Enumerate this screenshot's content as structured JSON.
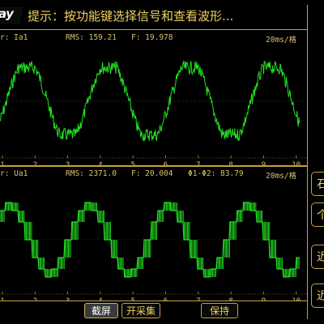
{
  "header": {
    "logo": "ay",
    "prompt": "提示：按功能键选择信号和查看波形..."
  },
  "panel_top": {
    "channel": "r: Ia1",
    "rms": "RMS: 159.21",
    "freq": "F: 19.978",
    "scale": "20ms/格",
    "ticks": [
      "1",
      "2",
      "3",
      "4",
      "5",
      "6",
      "7",
      "8",
      "9",
      "10"
    ]
  },
  "panel_bottom": {
    "channel": "r: Ua1",
    "rms": "RMS: 2371.0",
    "freq": "F: 20.004",
    "phase": "Φ1-Φ2: 83.79",
    "scale": "20ms/格",
    "ticks": [
      "1",
      "2",
      "3",
      "4",
      "5",
      "6",
      "7",
      "8",
      "9",
      "10"
    ]
  },
  "side_buttons": [
    "石",
    "个",
    "近",
    "近"
  ],
  "bottom_buttons": {
    "screenshot": "截屏",
    "start_capture": "开采集",
    "hold": "保持"
  },
  "colors": {
    "wave": "#22e022",
    "frame": "#c8a040",
    "text": "#f0d060"
  }
}
